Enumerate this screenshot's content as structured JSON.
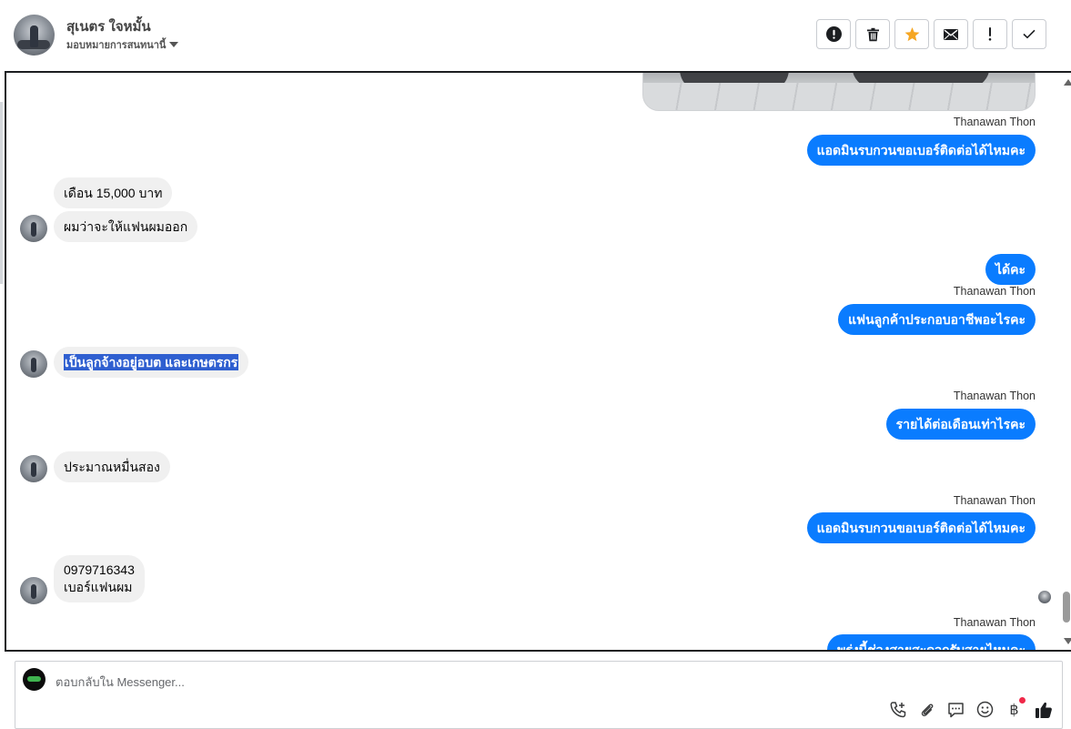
{
  "header": {
    "contact_name": "สุเนตร ใจหมั้น",
    "assign_label": "มอบหมายการสนทนานี้"
  },
  "toolbar": {
    "buttons": [
      "alert-circle-icon",
      "trash-icon",
      "star-icon",
      "mail-icon",
      "exclamation-icon",
      "check-icon"
    ],
    "star_color": "#f5a623"
  },
  "messages": [
    {
      "dir": "out",
      "type": "image"
    },
    {
      "dir": "out",
      "sender": "Thanawan Thon",
      "text": "แอดมินรบกวนขอเบอร์ติดต่อได้ไหมคะ"
    },
    {
      "dir": "in",
      "text": "เดือน 15,000 บาท"
    },
    {
      "dir": "in",
      "text": "ผมว่าจะให้แฟนผมออก"
    },
    {
      "dir": "out",
      "text": "ได้คะ"
    },
    {
      "dir": "out",
      "sender": "Thanawan Thon",
      "text": "แฟนลูกค้าประกอบอาชีพอะไรคะ"
    },
    {
      "dir": "in",
      "text": "เป็นลูกจ้างอยู่อบต และเกษตรกร",
      "selected": true
    },
    {
      "dir": "out",
      "sender": "Thanawan Thon",
      "text": "รายได้ต่อเดือนเท่าไรคะ"
    },
    {
      "dir": "in",
      "text": "ประมาณหมื่นสอง"
    },
    {
      "dir": "out",
      "sender": "Thanawan Thon",
      "text": "แอดมินรบกวนขอเบอร์ติดต่อได้ไหมคะ"
    },
    {
      "dir": "in",
      "text_line1": "0979716343",
      "text_line2": "เบอร์แฟนผม"
    },
    {
      "dir": "out",
      "sender": "Thanawan Thon",
      "text": "พรุ่งนี้ช่วงสายสะดวกรับสายไหมคะ"
    }
  ],
  "composer": {
    "placeholder": "ตอบกลับใน Messenger...",
    "tools": [
      "phone-add-icon",
      "attachment-icon",
      "saved-reply-icon",
      "emoji-icon",
      "baht-icon",
      "like-icon"
    ],
    "baht_symbol": "฿"
  },
  "colors": {
    "outgoing_bubble": "#0a7cff",
    "incoming_bubble": "#f0f0f0",
    "selection": "#2f5fd0",
    "notification_dot": "#f02849"
  }
}
